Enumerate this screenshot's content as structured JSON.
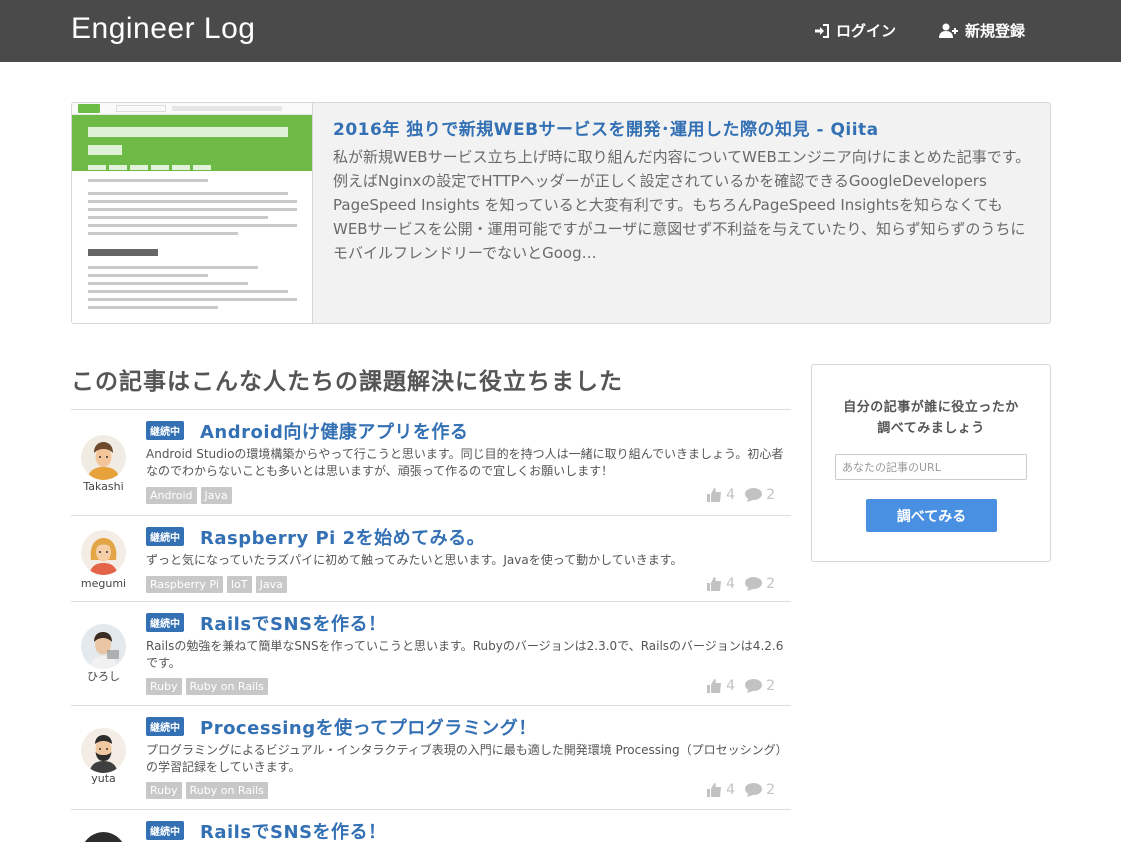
{
  "header": {
    "brand": "Engineer Log",
    "login_label": "ログイン",
    "signup_label": "新規登録"
  },
  "featured": {
    "title": "2016年 独りで新規WEBサービスを開発･運用した際の知見 - Qiita",
    "description": "私が新規WEBサービス立ち上げ時に取り組んだ内容についてWEBエンジニア向けにまとめた記事です。例えばNginxの設定でHTTPヘッダーが正しく設定されているかを確認できるGoogleDevelopers PageSpeed Insights を知っていると大変有利です。もちろんPageSpeed Insightsを知らなくてもWEBサービスを公開・運用可能ですがユーザに意図せず不利益を与えていたり、知らず知らずのうちにモバイルフレンドリーでないとGoog…"
  },
  "section": {
    "heading": "この記事はこんな人たちの課題解決に役立ちました"
  },
  "items": [
    {
      "user": "Takashi",
      "badge": "継続中",
      "title": "Android向け健康アプリを作る",
      "description": "Android Studioの環境構築からやって行こうと思います。同じ目的を持つ人は一緒に取り組んでいきましょう。初心者なのでわからないことも多いとは思いますが、頑張って作るので宜しくお願いします！",
      "tags": [
        "Android",
        "Java"
      ],
      "likes": "4",
      "comments": "2"
    },
    {
      "user": "megumi",
      "badge": "継続中",
      "title": "Raspberry Pi 2を始めてみる。",
      "description": "ずっと気になっていたラズパイに初めて触ってみたいと思います。Javaを使って動かしていきます。",
      "tags": [
        "Raspberry Pi",
        "IoT",
        "Java"
      ],
      "likes": "4",
      "comments": "2"
    },
    {
      "user": "ひろし",
      "badge": "継続中",
      "title": "RailsでSNSを作る！",
      "description": "Railsの勉強を兼ねて簡単なSNSを作っていこうと思います。Rubyのバージョンは2.3.0で、Railsのバージョンは4.2.6です。",
      "tags": [
        "Ruby",
        "Ruby on Rails"
      ],
      "likes": "4",
      "comments": "2"
    },
    {
      "user": "yuta",
      "badge": "継続中",
      "title": "Processingを使ってプログラミング！",
      "description": "プログラミングによるビジュアル・インタラクティブ表現の入門に最も適した開発環境 Processing（プロセッシング）の学習記録をしていきます。",
      "tags": [
        "Ruby",
        "Ruby on Rails"
      ],
      "likes": "4",
      "comments": "2"
    },
    {
      "badge": "継続中",
      "title": "RailsでSNSを作る！"
    }
  ],
  "sidebar": {
    "title_line1": "自分の記事が誰に役立ったか",
    "title_line2": "調べてみましょう",
    "url_placeholder": "あなたの記事のURL",
    "button_label": "調べてみる"
  },
  "colors": {
    "navbar": "#4a4a4a",
    "link_blue": "#3370b4",
    "button_blue": "#4a90e2",
    "tag_gray": "#c8c8c8"
  }
}
